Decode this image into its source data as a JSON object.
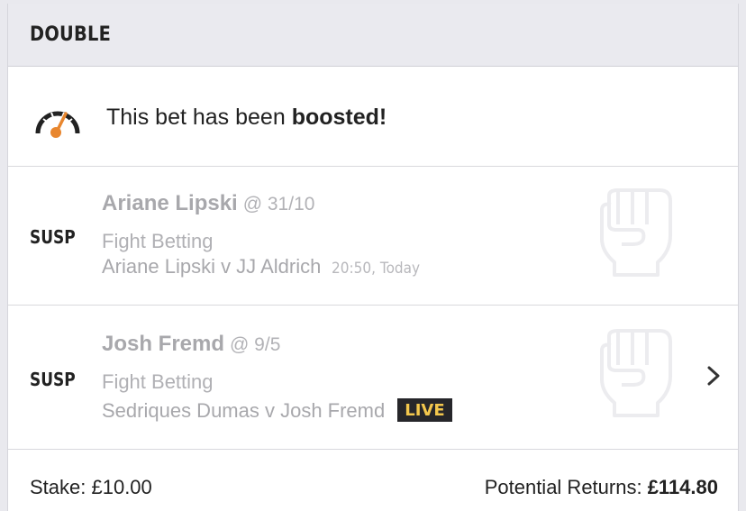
{
  "header": {
    "title": "DOUBLE"
  },
  "boost": {
    "icon": "speedometer-icon",
    "text": "This bet has been ",
    "text_bold": "boosted!",
    "accent_color": "#e8862e"
  },
  "selections": [
    {
      "status": "SUSP",
      "name": "Ariane Lipski",
      "odds": "@ 31/10",
      "market": "Fight Betting",
      "event": "Ariane Lipski v JJ Aldrich",
      "time": "20:50, Today",
      "icon": "fist-icon"
    },
    {
      "status": "SUSP",
      "name": "Josh Fremd",
      "odds": "@ 9/5",
      "market": "Fight Betting",
      "event": "Sedriques Dumas v Josh Fremd",
      "live": "LIVE",
      "icon": "fist-icon"
    }
  ],
  "footer": {
    "stake_label": "Stake: ",
    "stake_value": "£10.00",
    "returns_label": "Potential Returns: ",
    "returns_value": "£114.80"
  }
}
